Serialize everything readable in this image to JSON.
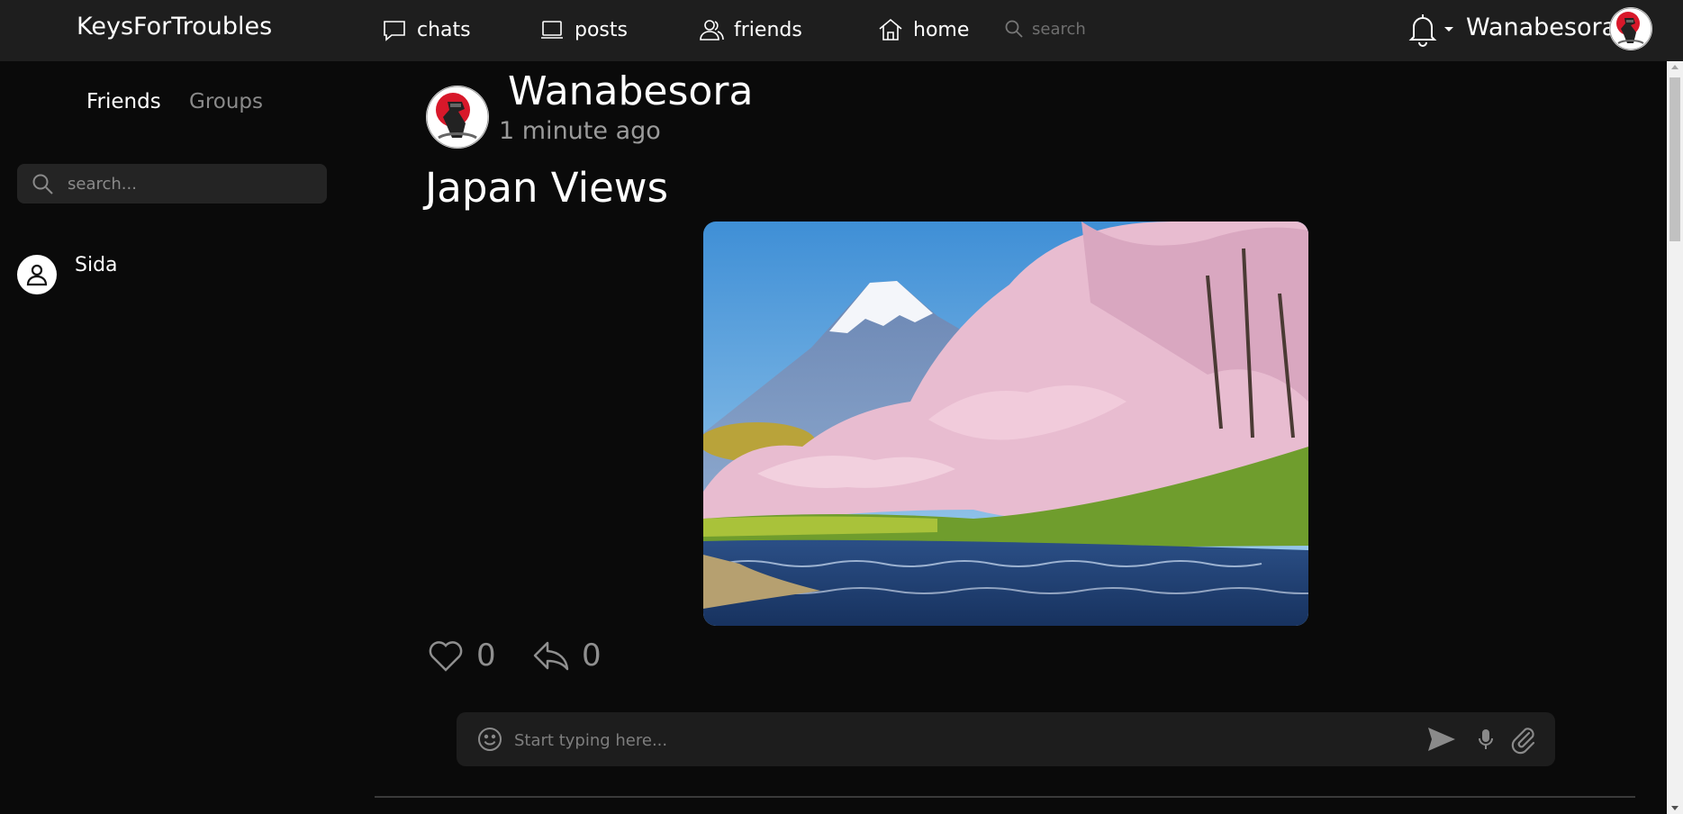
{
  "app": {
    "brand": "KeysForTroubles"
  },
  "nav": {
    "items": [
      {
        "label": "chats",
        "icon": "chat-bubble-icon"
      },
      {
        "label": "posts",
        "icon": "laptop-icon"
      },
      {
        "label": "friends",
        "icon": "users-icon"
      },
      {
        "label": "home",
        "icon": "home-icon"
      }
    ],
    "search_placeholder": "search"
  },
  "user": {
    "name": "Wanabesora",
    "notifications_icon": "bell-icon"
  },
  "sidebar": {
    "tabs": [
      {
        "label": "Friends",
        "active": true
      },
      {
        "label": "Groups",
        "active": false
      }
    ],
    "search_placeholder": "search...",
    "friends": [
      {
        "name": "Sida"
      }
    ]
  },
  "post": {
    "author": "Wanabesora",
    "time": "1 minute ago",
    "title": "Japan Views",
    "image_subject": "mount-fuji-cherry-blossoms-river",
    "likes": "0",
    "shares": "0"
  },
  "composer": {
    "placeholder": "Start typing here..."
  },
  "colors": {
    "background": "#0a0a0a",
    "topbar": "#1e1e1e",
    "panel": "#1d1d1d",
    "muted_text": "#8a8a8a",
    "avatar_red": "#d8182a"
  }
}
